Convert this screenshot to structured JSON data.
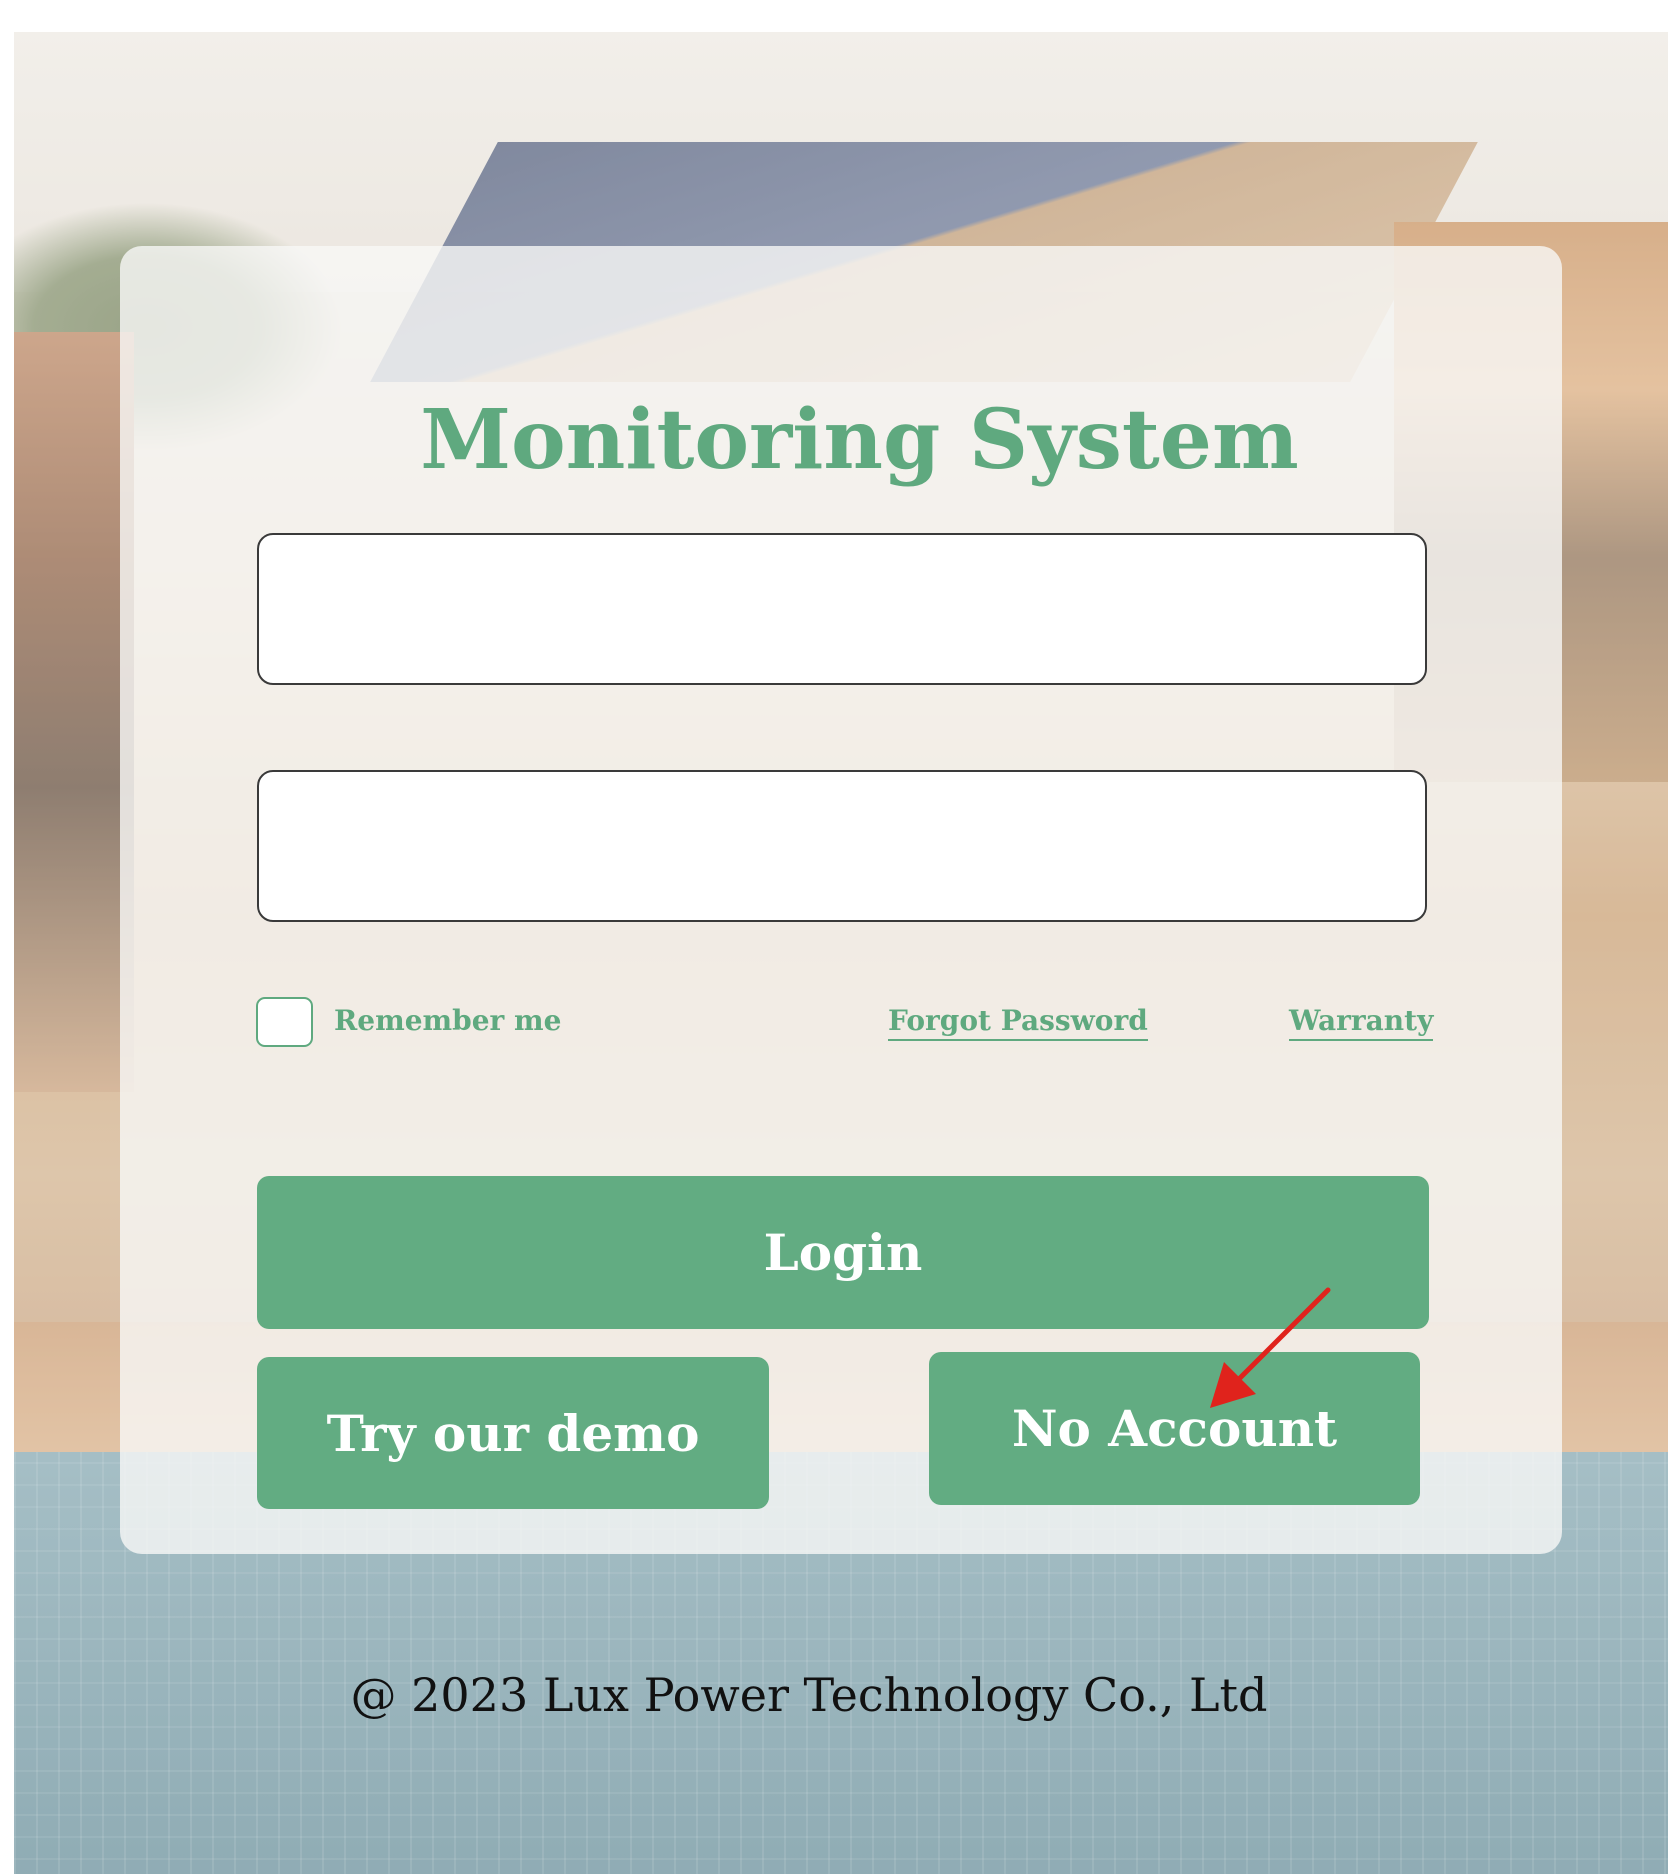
{
  "title": "Monitoring System",
  "form": {
    "username_value": "",
    "password_value": "",
    "remember_label": "Remember me",
    "forgot_label": "Forgot Password",
    "warranty_label": "Warranty",
    "login_label": "Login",
    "demo_label": "Try our demo",
    "no_account_label": "No Account"
  },
  "footer": "@ 2023 Lux Power Technology Co., Ltd",
  "colors": {
    "accent": "#62ac82",
    "title": "#5fa97f",
    "annotation_arrow": "#e0231c"
  },
  "icons": {
    "annotation": "red-arrow-icon"
  }
}
